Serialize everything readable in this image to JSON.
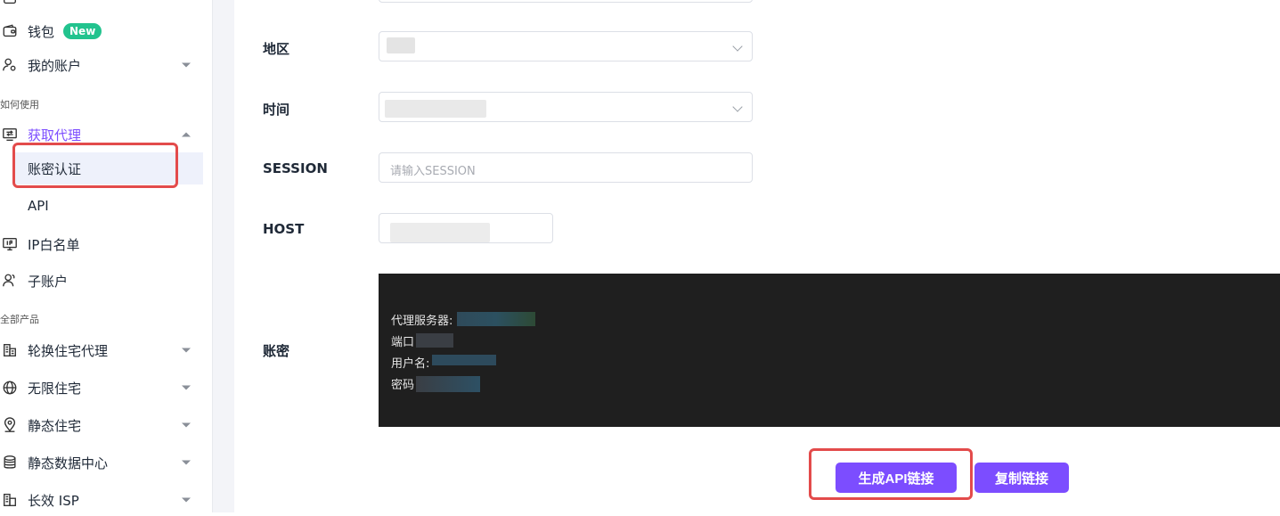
{
  "sidebar": {
    "wallet_label": "钱包",
    "wallet_badge": "New",
    "my_account_label": "我的账户",
    "section_how_to_use": "如何使用",
    "get_proxy_label": "获取代理",
    "sub_account_password": "账密认证",
    "sub_api": "API",
    "ip_whitelist_label": "IP白名单",
    "sub_accounts_label": "子账户",
    "section_all_products": "全部产品",
    "rotating_residential_label": "轮换住宅代理",
    "unlimited_residential_label": "无限住宅",
    "static_residential_label": "静态住宅",
    "static_datacenter_label": "静态数据中心",
    "long_isp_label": "长效 ISP"
  },
  "form": {
    "region_label": "地区",
    "time_label": "时间",
    "session_label": "SESSION",
    "session_placeholder": "请输入SESSION",
    "host_label": "HOST",
    "account_label": "账密"
  },
  "console": {
    "proxy_server": "代理服务器:",
    "port": "端口",
    "username": "用户名:",
    "password": "密码"
  },
  "actions": {
    "generate_api_link": "生成API链接",
    "copy_link": "复制链接"
  },
  "colors": {
    "accent": "#7c4dff",
    "highlight": "#e34b4b",
    "badge": "#22c38e"
  }
}
